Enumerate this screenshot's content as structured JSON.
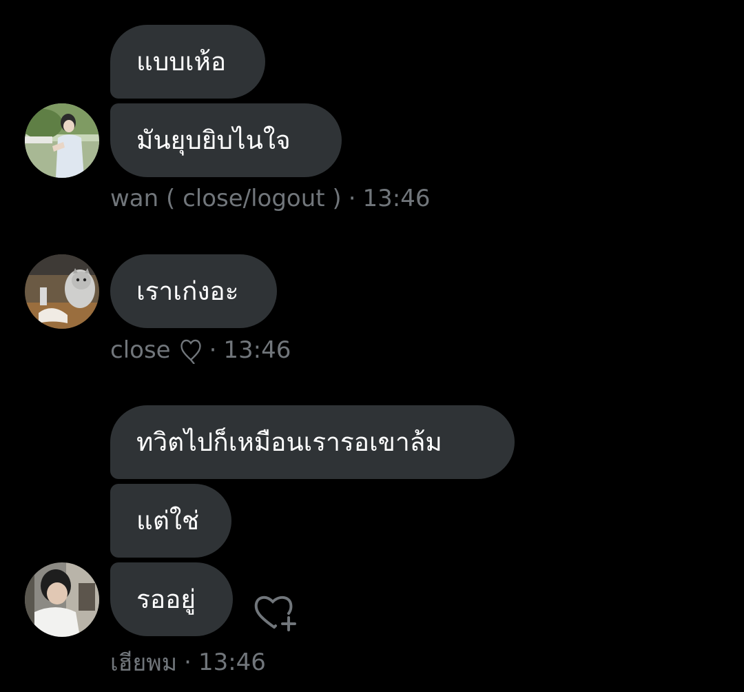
{
  "groups": [
    {
      "messages": [
        "แบบเห้อ",
        "มันยุบยิบไนใจ"
      ],
      "sender": "wan ( close/logout )",
      "time": "13:46"
    },
    {
      "messages": [
        "เราเก่งอะ"
      ],
      "sender": "close",
      "sender_emoji": "heart-outline",
      "time": "13:46"
    },
    {
      "messages": [
        "ทวิตไปก็เหมือนเรารอเขาล้ม",
        "แต่ใช่",
        "รออยู่"
      ],
      "sender": "เฮียพม",
      "time": "13:46"
    }
  ],
  "separator": "·",
  "colors": {
    "bubble": "#2f3336",
    "meta": "#71767b",
    "background": "#000000"
  }
}
